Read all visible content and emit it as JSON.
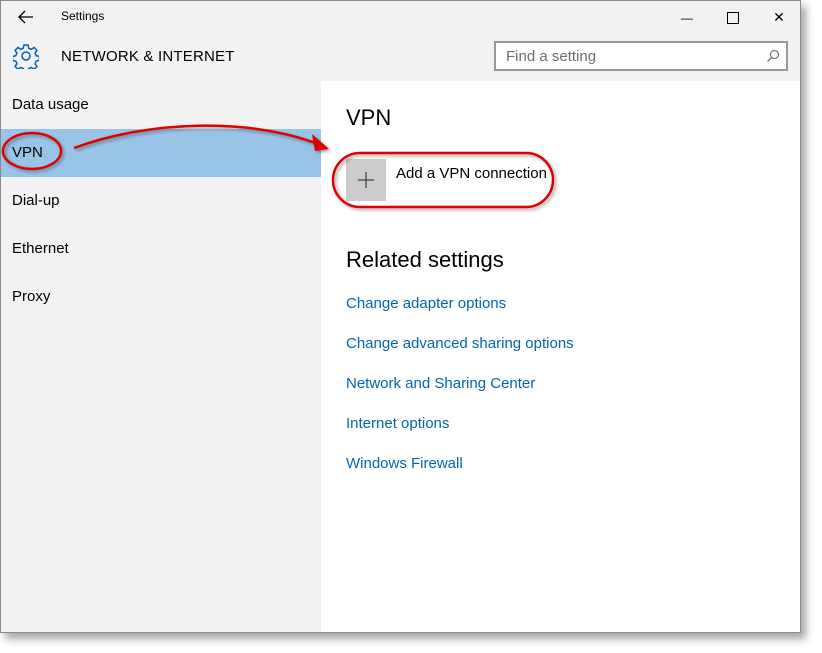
{
  "titlebar": {
    "title": "Settings",
    "back_icon": "back-arrow-icon",
    "minimize_glyph": "—",
    "close_glyph": "✕"
  },
  "header": {
    "section_title": "NETWORK & INTERNET",
    "icon": "gear-icon",
    "search": {
      "placeholder": "Find a setting",
      "icon": "search-icon"
    }
  },
  "sidebar": {
    "items": [
      {
        "label": "Data usage"
      },
      {
        "label": "VPN",
        "selected": true
      },
      {
        "label": "Dial-up"
      },
      {
        "label": "Ethernet"
      },
      {
        "label": "Proxy"
      }
    ]
  },
  "content": {
    "title": "VPN",
    "add_vpn": {
      "label": "Add a VPN connection",
      "icon": "plus-icon"
    },
    "related_title": "Related settings",
    "links": [
      "Change adapter options",
      "Change advanced sharing options",
      "Network and Sharing Center",
      "Internet options",
      "Windows Firewall"
    ]
  },
  "colors": {
    "accent_blue": "#0066b4",
    "selection": "#99c4e8",
    "annotation_red": "#e00000",
    "settings_icon": "#0063b1"
  }
}
